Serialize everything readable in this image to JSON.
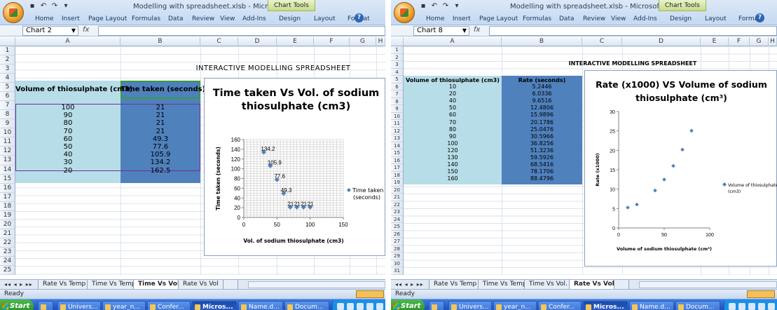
{
  "left": {
    "window_title": "Modelling with spreadsheet.xlsb - Microsoft Excel",
    "chart_tools_label": "Chart Tools",
    "ribbon_tabs": [
      "Home",
      "Insert",
      "Page Layout",
      "Formulas",
      "Data",
      "Review",
      "View",
      "Add-Ins",
      "Design",
      "Layout",
      "Format"
    ],
    "name_box": "Chart 2",
    "fx_label": "fx",
    "columns": [
      "A",
      "B",
      "C",
      "D",
      "E",
      "F",
      "G",
      "H"
    ],
    "rows": [
      "1",
      "2",
      "3",
      "4",
      "5",
      "6",
      "7",
      "8",
      "9",
      "10",
      "11",
      "12",
      "13",
      "14",
      "15",
      "16",
      "17",
      "18",
      "19",
      "20",
      "21",
      "22",
      "23",
      "24",
      "25"
    ],
    "sheet_heading": "INTERACTIVE MODELLING SPREADSHEET",
    "header_a": "Volume of thiosulphate (cm3)",
    "header_b": "Time taken (seconds)",
    "table": [
      {
        "vol": "100",
        "time": "21"
      },
      {
        "vol": "90",
        "time": "21"
      },
      {
        "vol": "80",
        "time": "21"
      },
      {
        "vol": "70",
        "time": "21"
      },
      {
        "vol": "60",
        "time": "49.3"
      },
      {
        "vol": "50",
        "time": "77.6"
      },
      {
        "vol": "40",
        "time": "105.9"
      },
      {
        "vol": "30",
        "time": "134.2"
      },
      {
        "vol": "20",
        "time": "162.5"
      }
    ],
    "sheet_tabs": [
      "Rate Vs Temp",
      "Time Vs Temp",
      "Time Vs Vol.",
      "Rate Vs Vol"
    ],
    "active_sheet": "Time Vs Vol.",
    "status": "Ready"
  },
  "right": {
    "window_title": "Modelling with spreadsheet.xlsb - Microsoft Excel",
    "chart_tools_label": "Chart Tools",
    "ribbon_tabs": [
      "Home",
      "Insert",
      "Page Layout",
      "Formulas",
      "Data",
      "Review",
      "View",
      "Add-Ins",
      "Design",
      "Layout",
      "Format"
    ],
    "name_box": "Chart 8",
    "fx_label": "fx",
    "columns": [
      "A",
      "B",
      "C",
      "D",
      "E",
      "F",
      "G",
      "H"
    ],
    "rows": [
      "1",
      "2",
      "3",
      "4",
      "5",
      "6",
      "7",
      "8",
      "9",
      "10",
      "11",
      "12",
      "13",
      "14",
      "15",
      "16",
      "17",
      "18",
      "19",
      "20",
      "21",
      "22",
      "23",
      "24",
      "25",
      "26",
      "27",
      "28",
      "29",
      "30",
      "31"
    ],
    "sheet_heading": "INTERACTIVE MODELLING SPREADSHEET",
    "header_a": "Volume of thiosulphate (cm3)",
    "header_b": "Rate (seconds)",
    "table": [
      {
        "vol": "10",
        "rate": "5.2446"
      },
      {
        "vol": "20",
        "rate": "6.0336"
      },
      {
        "vol": "40",
        "rate": "9.6516"
      },
      {
        "vol": "50",
        "rate": "12.4806"
      },
      {
        "vol": "60",
        "rate": "15.9896"
      },
      {
        "vol": "70",
        "rate": "20.1786"
      },
      {
        "vol": "80",
        "rate": "25.0476"
      },
      {
        "vol": "90",
        "rate": "30.5966"
      },
      {
        "vol": "100",
        "rate": "36.8256"
      },
      {
        "vol": "120",
        "rate": "51.3236"
      },
      {
        "vol": "130",
        "rate": "59.5926"
      },
      {
        "vol": "140",
        "rate": "68.5416"
      },
      {
        "vol": "150",
        "rate": "78.1706"
      },
      {
        "vol": "160",
        "rate": "88.4796"
      }
    ],
    "sheet_tabs": [
      "Rate Vs Temp",
      "Time Vs Temp",
      "Time Vs Vol.",
      "Rate Vs Vol"
    ],
    "active_sheet": "Rate Vs Vol",
    "status": "Ready"
  },
  "taskbar": {
    "start_label": "Start",
    "items": [
      "Univers...",
      "year_n...",
      "Confer...",
      "Micros...",
      "Name.d...",
      "Docum..."
    ],
    "active_item": "Micros..."
  },
  "colors": {
    "table_a_fill": "#b7dde8",
    "table_b_fill": "#4f81bd",
    "series_marker": "#4f81bd",
    "ribbon": "#c5d9f1"
  },
  "chart_data": [
    {
      "type": "scatter",
      "title": "Time taken Vs Vol. of sodium thiosulphate (cm3)",
      "xlabel": "Vol. of sodium thiosulphate (cm3)",
      "ylabel": "Time taken (seconds)",
      "xlim": [
        0,
        150
      ],
      "ylim": [
        0,
        160
      ],
      "x_ticks": [
        "0",
        "50",
        "100",
        "150"
      ],
      "y_ticks": [
        "0",
        "20",
        "40",
        "60",
        "80",
        "100",
        "120",
        "140",
        "160"
      ],
      "grid": true,
      "legend_position": "right",
      "series": [
        {
          "name": "Time taken (seconds)",
          "x": [
            30,
            40,
            50,
            60,
            70,
            80,
            90,
            100
          ],
          "y": [
            134.2,
            105.9,
            77.6,
            49.3,
            21,
            21,
            21,
            21
          ],
          "labels": [
            "134.2",
            "105.9",
            "77.6",
            "49.3",
            "21",
            "21",
            "21",
            "21"
          ]
        }
      ]
    },
    {
      "type": "scatter",
      "title": "Rate (x1000) VS Volume of sodium thiosulphate (cm³)",
      "xlabel": "Volume of sodium thiosulphate (cm³)",
      "ylabel": "Rate (x1000)",
      "xlim": [
        0,
        100
      ],
      "ylim": [
        0,
        30
      ],
      "x_ticks": [
        "0",
        "50",
        "100"
      ],
      "y_ticks": [
        "0",
        "5",
        "10",
        "15",
        "20",
        "25",
        "30"
      ],
      "grid": false,
      "legend_position": "right",
      "series": [
        {
          "name": "Volume of thiosulphate (cm3)",
          "x": [
            10,
            20,
            40,
            50,
            60,
            70,
            80
          ],
          "y": [
            5.2446,
            6.0336,
            9.6516,
            12.4806,
            15.9896,
            20.1786,
            25.0476
          ]
        }
      ]
    }
  ]
}
